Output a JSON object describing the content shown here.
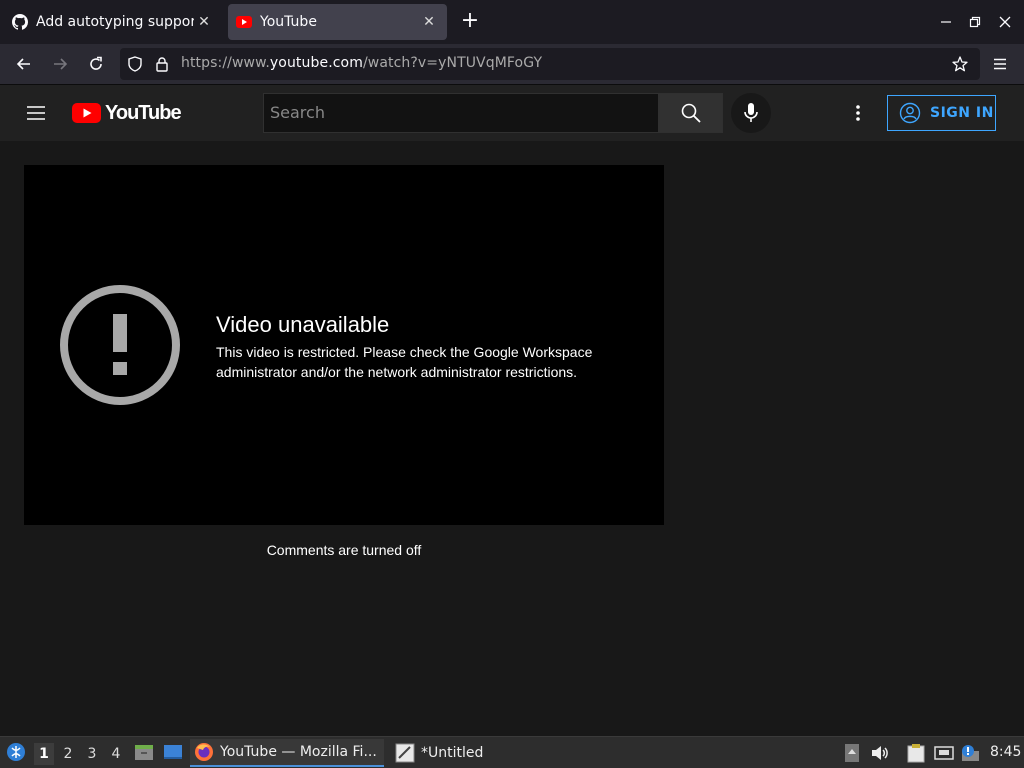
{
  "browser": {
    "tabs": [
      {
        "label": "Add autotyping support",
        "active": false,
        "favicon": "github-icon"
      },
      {
        "label": "YouTube",
        "active": true,
        "favicon": "youtube-icon"
      }
    ],
    "url_prefix": "https://www.",
    "url_domain": "youtube.com",
    "url_path": "/watch?v=yNTUVqMFoGY"
  },
  "youtube": {
    "logo_text": "YouTube",
    "search_placeholder": "Search",
    "sign_in_label": "SIGN IN",
    "error_title": "Video unavailable",
    "error_message": "This video is restricted. Please check the Google Workspace administrator and/or the network administrator restrictions.",
    "comments_status": "Comments are turned off",
    "colors": {
      "accent": "#3ea6ff",
      "logo_red": "#ff0000",
      "background": "#181818"
    }
  },
  "taskbar": {
    "workspaces": [
      "1",
      "2",
      "3",
      "4"
    ],
    "active_workspace": "1",
    "tasks": [
      {
        "label": "YouTube — Mozilla Fi...",
        "icon": "firefox-icon",
        "active": true
      },
      {
        "label": "*Untitled",
        "icon": "text-editor-icon",
        "active": false
      }
    ],
    "clock": "8:45"
  }
}
